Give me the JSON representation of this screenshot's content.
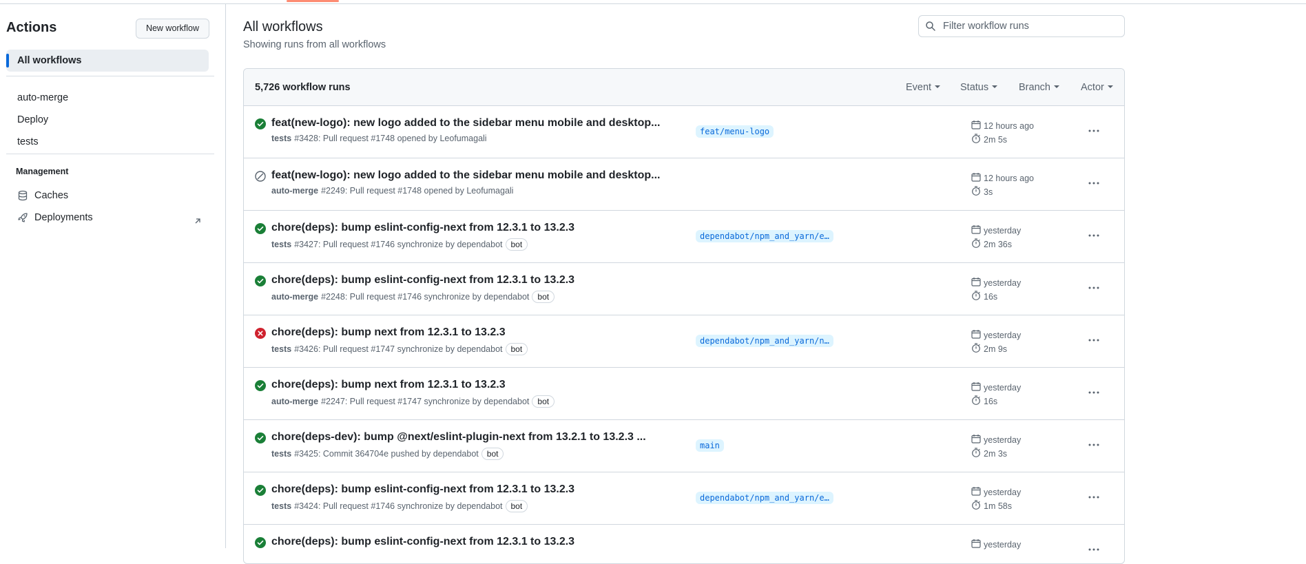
{
  "sidebar": {
    "title": "Actions",
    "new_workflow_label": "New workflow",
    "active_item": "All workflows",
    "workflows": [
      {
        "label": "auto-merge"
      },
      {
        "label": "Deploy"
      },
      {
        "label": "tests"
      }
    ],
    "section_title": "Management",
    "management": [
      {
        "label": "Caches",
        "icon": "database-icon"
      },
      {
        "label": "Deployments",
        "icon": "rocket-icon",
        "external": true
      }
    ]
  },
  "main": {
    "title": "All workflows",
    "subtitle": "Showing runs from all workflows",
    "filter_placeholder": "Filter workflow runs",
    "runs_count": "5,726 workflow runs",
    "filters": [
      "Event",
      "Status",
      "Branch",
      "Actor"
    ],
    "runs": [
      {
        "status": "success",
        "title": "feat(new-logo): new logo added to the sidebar menu mobile and desktop...",
        "workflow": "tests",
        "detail": "#3428: Pull request #1748 opened by Leofumagali",
        "bot": false,
        "branch": "feat/menu-logo",
        "time": "12 hours ago",
        "duration": "2m 5s"
      },
      {
        "status": "skipped",
        "title": "feat(new-logo): new logo added to the sidebar menu mobile and desktop...",
        "workflow": "auto-merge",
        "detail": "#2249: Pull request #1748 opened by Leofumagali",
        "bot": false,
        "branch": "",
        "time": "12 hours ago",
        "duration": "3s"
      },
      {
        "status": "success",
        "title": "chore(deps): bump eslint-config-next from 12.3.1 to 13.2.3",
        "workflow": "tests",
        "detail": "#3427: Pull request #1746 synchronize by dependabot",
        "bot": true,
        "branch": "dependabot/npm_and_yarn/e…",
        "time": "yesterday",
        "duration": "2m 36s"
      },
      {
        "status": "success",
        "title": "chore(deps): bump eslint-config-next from 12.3.1 to 13.2.3",
        "workflow": "auto-merge",
        "detail": "#2248: Pull request #1746 synchronize by dependabot",
        "bot": true,
        "branch": "",
        "time": "yesterday",
        "duration": "16s"
      },
      {
        "status": "failure",
        "title": "chore(deps): bump next from 12.3.1 to 13.2.3",
        "workflow": "tests",
        "detail": "#3426: Pull request #1747 synchronize by dependabot",
        "bot": true,
        "branch": "dependabot/npm_and_yarn/n…",
        "time": "yesterday",
        "duration": "2m 9s"
      },
      {
        "status": "success",
        "title": "chore(deps): bump next from 12.3.1 to 13.2.3",
        "workflow": "auto-merge",
        "detail": "#2247: Pull request #1747 synchronize by dependabot",
        "bot": true,
        "branch": "",
        "time": "yesterday",
        "duration": "16s"
      },
      {
        "status": "success",
        "title": "chore(deps-dev): bump @next/eslint-plugin-next from 13.2.1 to 13.2.3 ...",
        "workflow": "tests",
        "detail": "#3425: Commit 364704e pushed by dependabot",
        "bot": true,
        "branch": "main",
        "time": "yesterday",
        "duration": "2m 3s"
      },
      {
        "status": "success",
        "title": "chore(deps): bump eslint-config-next from 12.3.1 to 13.2.3",
        "workflow": "tests",
        "detail": "#3424: Pull request #1746 synchronize by dependabot",
        "bot": true,
        "branch": "dependabot/npm_and_yarn/e…",
        "time": "yesterday",
        "duration": "1m 58s"
      },
      {
        "status": "success",
        "title": "chore(deps): bump eslint-config-next from 12.3.1 to 13.2.3",
        "workflow": "",
        "detail": "",
        "bot": false,
        "branch": "",
        "time": "yesterday",
        "duration": ""
      }
    ],
    "bot_label": "bot"
  },
  "colors": {
    "success": "#1a7f37",
    "failure": "#cf222e",
    "skipped": "#59636e",
    "accent": "#0969da"
  }
}
